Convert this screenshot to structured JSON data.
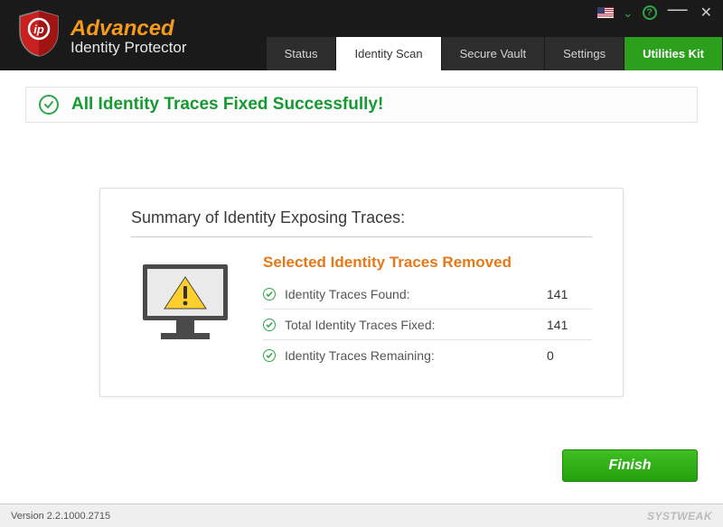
{
  "brand": {
    "line1": "Advanced",
    "line2": "Identity Protector"
  },
  "tabs": {
    "status": "Status",
    "identity_scan": "Identity Scan",
    "secure_vault": "Secure Vault",
    "settings": "Settings",
    "utilities": "Utilities Kit"
  },
  "banner_message": "All Identity Traces Fixed Successfully!",
  "card": {
    "heading": "Summary of Identity Exposing Traces:",
    "subtitle": "Selected Identity Traces Removed",
    "rows": [
      {
        "label": "Identity Traces Found:",
        "value": "141"
      },
      {
        "label": "Total Identity Traces Fixed:",
        "value": "141"
      },
      {
        "label": "Identity Traces Remaining:",
        "value": "0"
      }
    ]
  },
  "finish_label": "Finish",
  "footer": {
    "version": "Version 2.2.1000.2715",
    "watermark": "SYSTWEAK"
  }
}
